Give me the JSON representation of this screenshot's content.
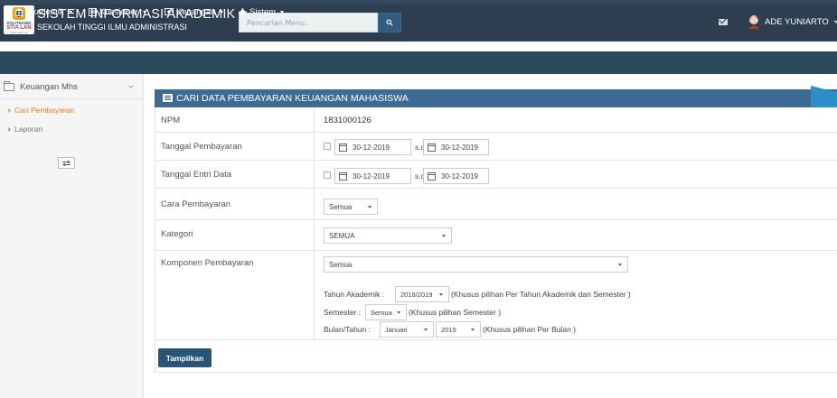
{
  "app": {
    "logo": {
      "line1": "POLITEKNIK",
      "line2": "STIA LAN",
      "line3": "JAKARTA"
    },
    "title": "SISTEM INFORMASI AKADEMIK",
    "subtitle": "SEKOLAH TINGGI ILMU ADMINISTRASI"
  },
  "search": {
    "placeholder": "Pencarian Menu.."
  },
  "user": {
    "name": "ADE YUNIARTO"
  },
  "menu": {
    "items": [
      {
        "label": "Akademik",
        "icon": "bank-icon"
      },
      {
        "label": "Kuesioner",
        "icon": "document-icon"
      },
      {
        "label": "Keuangan",
        "icon": "money-icon"
      },
      {
        "label": "Sistem",
        "icon": "gear-icon"
      }
    ]
  },
  "sidebar": {
    "header": "Keuangan Mhs",
    "items": [
      {
        "label": "Cari Pembayaran",
        "active": true
      },
      {
        "label": "Laporan",
        "active": false
      }
    ]
  },
  "panel": {
    "title": "CARI DATA PEMBAYARAN KEUANGAN MAHASISWA",
    "rows": {
      "npm": {
        "label": "NPM",
        "value": "1831000126"
      },
      "tanggal_pembayaran": {
        "label": "Tanggal Pembayaran",
        "from": "30-12-2019",
        "sd": "s.d",
        "to": "30-12-2019"
      },
      "tanggal_entri": {
        "label": "Tanggal Entri Data",
        "from": "30-12-2019",
        "sd": "s.d",
        "to": "30-12-2019"
      },
      "cara": {
        "label": "Cara Pembayaran",
        "value": "Semua"
      },
      "kategori": {
        "label": "Kategori",
        "value": "SEMUA"
      },
      "komponen": {
        "label": "Komponen Pembayaran",
        "value": "Semua",
        "tahun_label": "Tahun Akademik :",
        "tahun_value": "2018/2019",
        "tahun_note": "(Khusus pilihan Per Tahun Akademik dan Semester )",
        "semester_label": "Semester :",
        "semester_value": "Semua",
        "semester_note": "(Khusus pilihan Semester )",
        "bulan_label": "Bulan/Tahun :",
        "bulan_value": "Januari",
        "tahun2_value": "2019",
        "bulan_note": "(Khusus pilihan Per Bulan )"
      }
    },
    "submit_label": "Tampilkan"
  },
  "colors": {
    "header_bg": "#2c3e50",
    "menubar_bg": "#2c4a5e",
    "panel_header": "#3d6b95",
    "accent_active": "#e67e22",
    "button": "#2a5476"
  }
}
